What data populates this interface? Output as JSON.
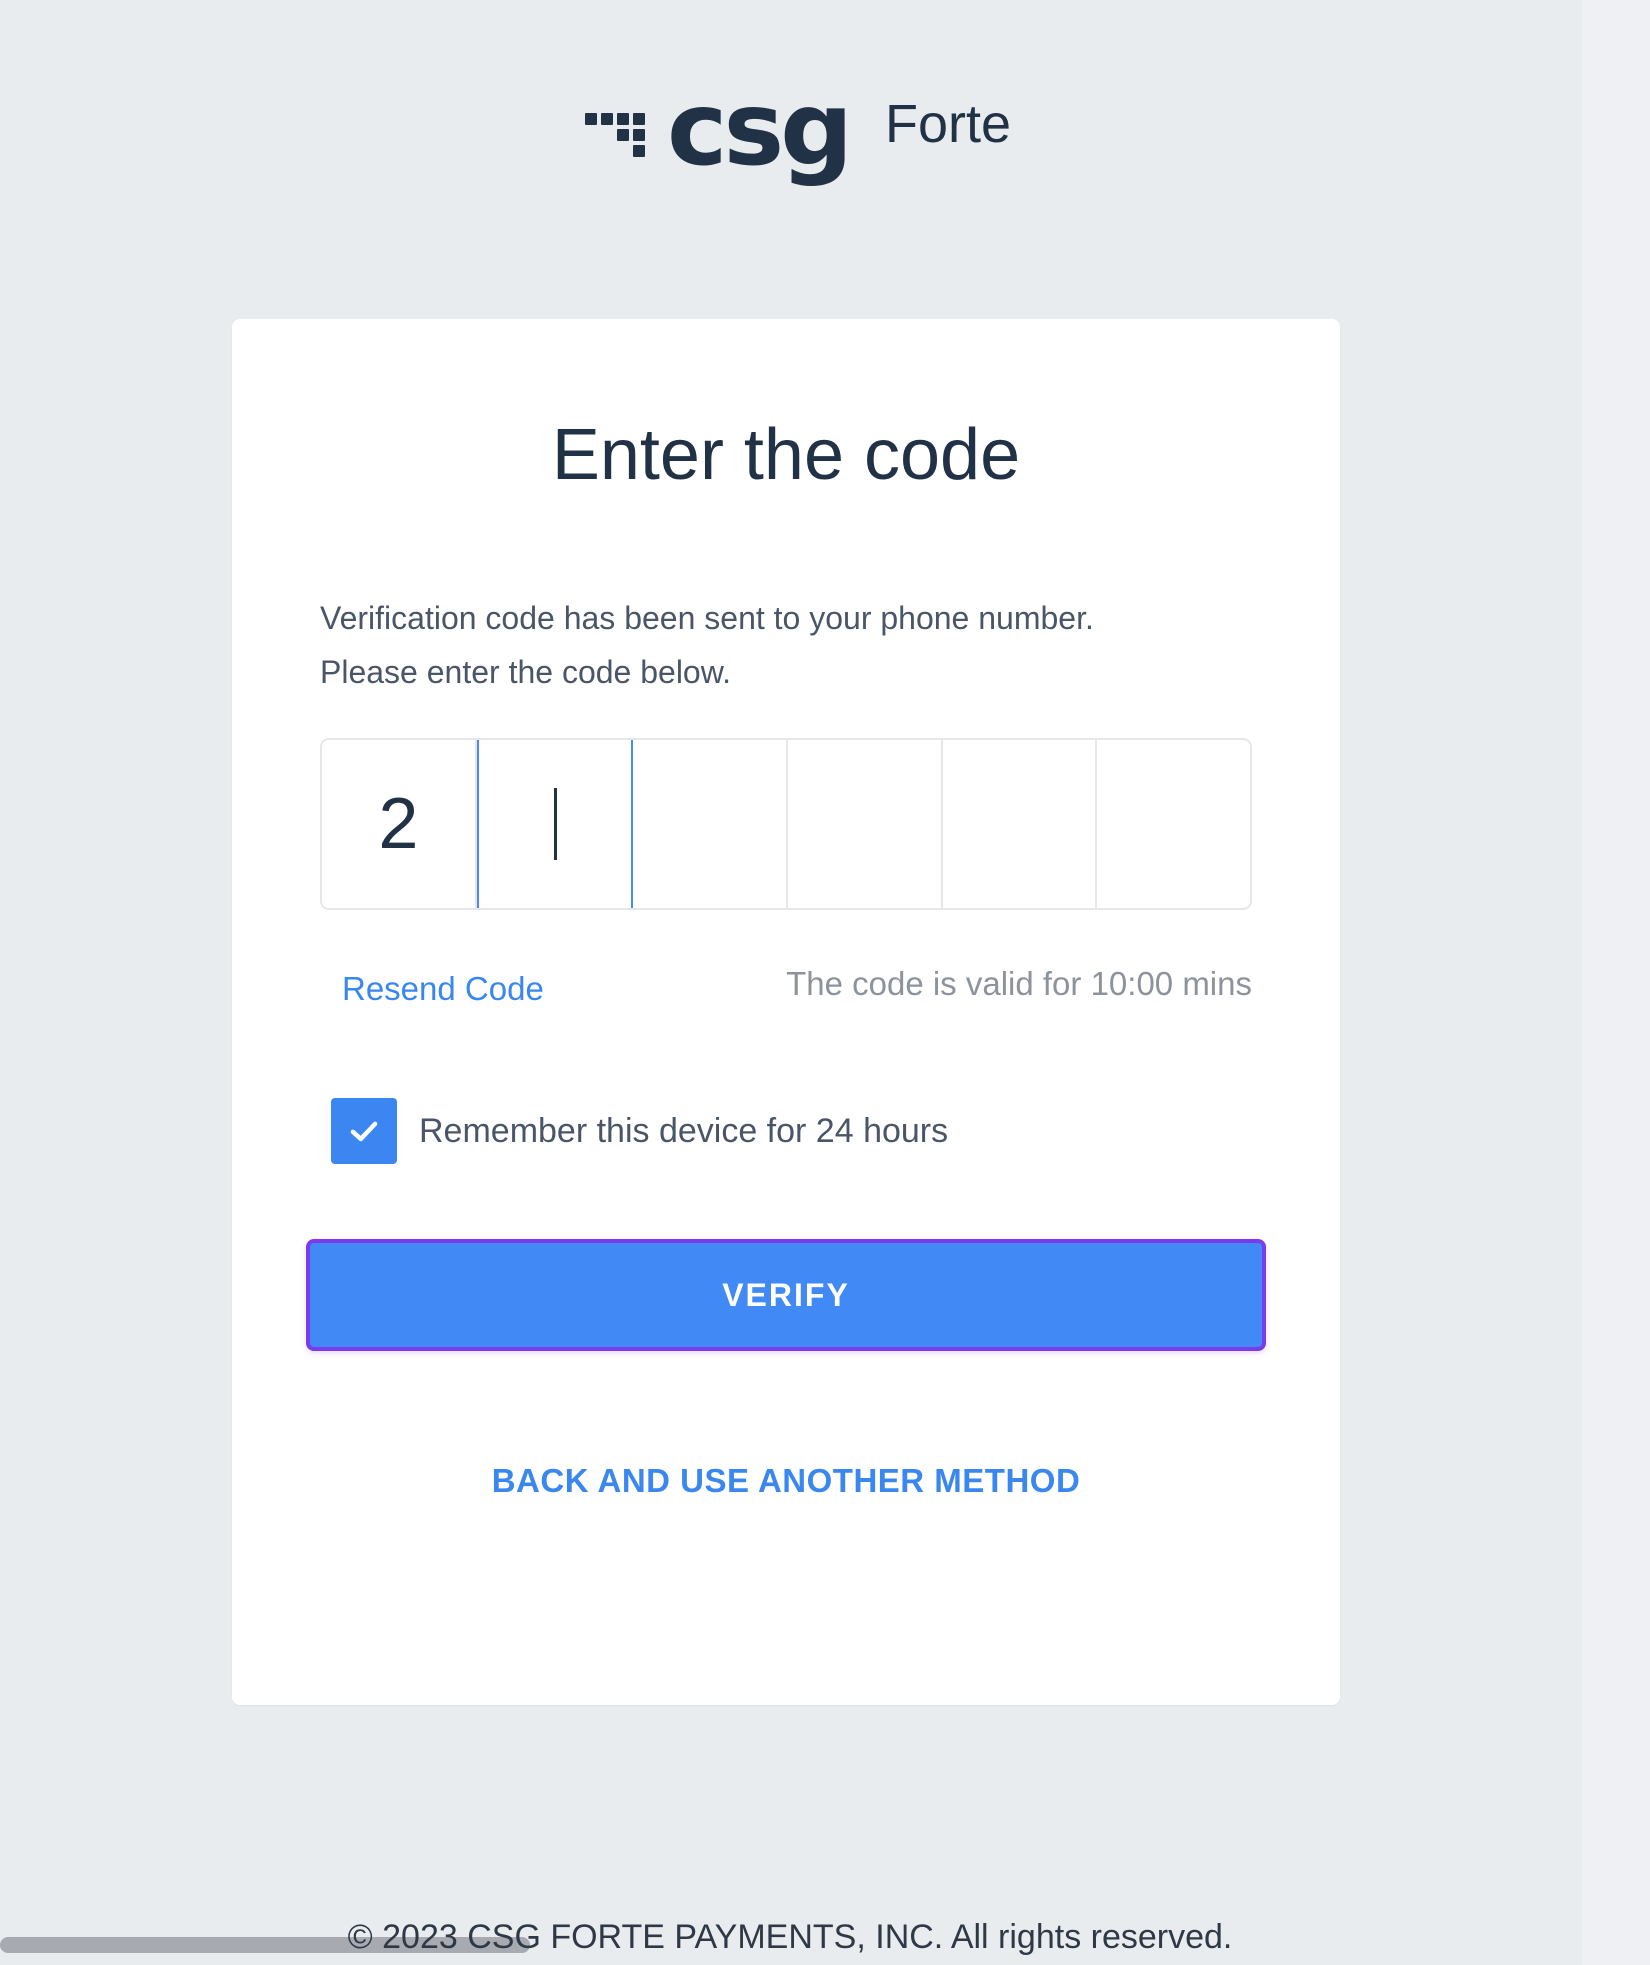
{
  "brand": {
    "logo_text": "csg",
    "logo_sub": "Forte"
  },
  "card": {
    "title": "Enter the code",
    "description_line1": "Verification code has been sent to your phone number.",
    "description_line2": "Please enter the code below."
  },
  "otp": {
    "digits": [
      "2",
      "",
      "",
      "",
      "",
      ""
    ],
    "focused_index": 1
  },
  "links": {
    "resend": "Resend Code",
    "validity": "The code is valid for 10:00 mins",
    "back": "BACK AND USE ANOTHER METHOD"
  },
  "remember": {
    "label": "Remember this device for 24 hours",
    "checked": true
  },
  "buttons": {
    "verify": "VERIFY"
  },
  "footer": {
    "copyright": "© 2023 CSG FORTE PAYMENTS, INC. All rights reserved."
  },
  "colors": {
    "background": "#e9ecef",
    "brand_dark": "#223246",
    "accent_blue": "#4189f4",
    "focus_outline": "#7c3aed"
  }
}
